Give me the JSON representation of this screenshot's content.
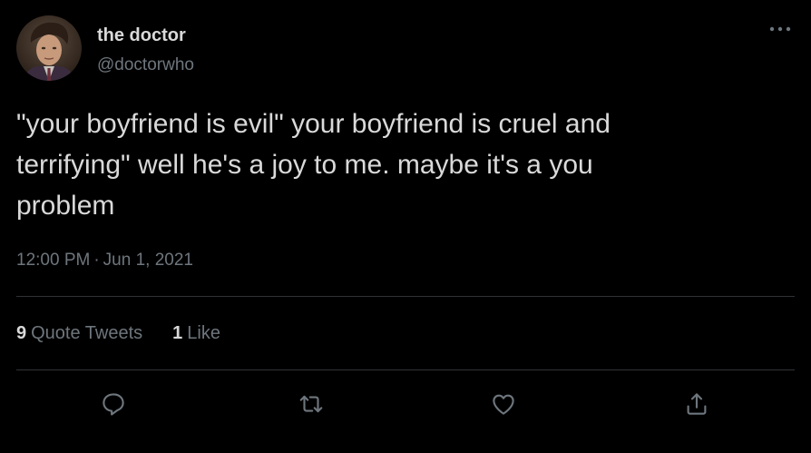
{
  "author": {
    "display_name": "the doctor",
    "handle": "@doctorwho",
    "avatar_icon": "profile-photo"
  },
  "tweet": {
    "text": "\"your boyfriend is evil\" your boyfriend is cruel and\nterrifying\" well he's a joy to me. maybe it's a you\nproblem",
    "time": "12:00 PM",
    "separator": "·",
    "date": "Jun 1, 2021"
  },
  "stats": {
    "quote_tweets_count": "9",
    "quote_tweets_label": "Quote Tweets",
    "likes_count": "1",
    "likes_label": "Like"
  },
  "actions": [
    {
      "name": "reply",
      "icon": "speech-bubble-icon"
    },
    {
      "name": "retweet",
      "icon": "retweet-arrows-icon"
    },
    {
      "name": "like",
      "icon": "heart-icon"
    },
    {
      "name": "share",
      "icon": "share-upload-icon"
    }
  ],
  "colors": {
    "background": "#000000",
    "primary_text": "#d9d9d9",
    "secondary_text": "#6e767d",
    "divider": "#2f3336",
    "icon": "#6e767d"
  }
}
